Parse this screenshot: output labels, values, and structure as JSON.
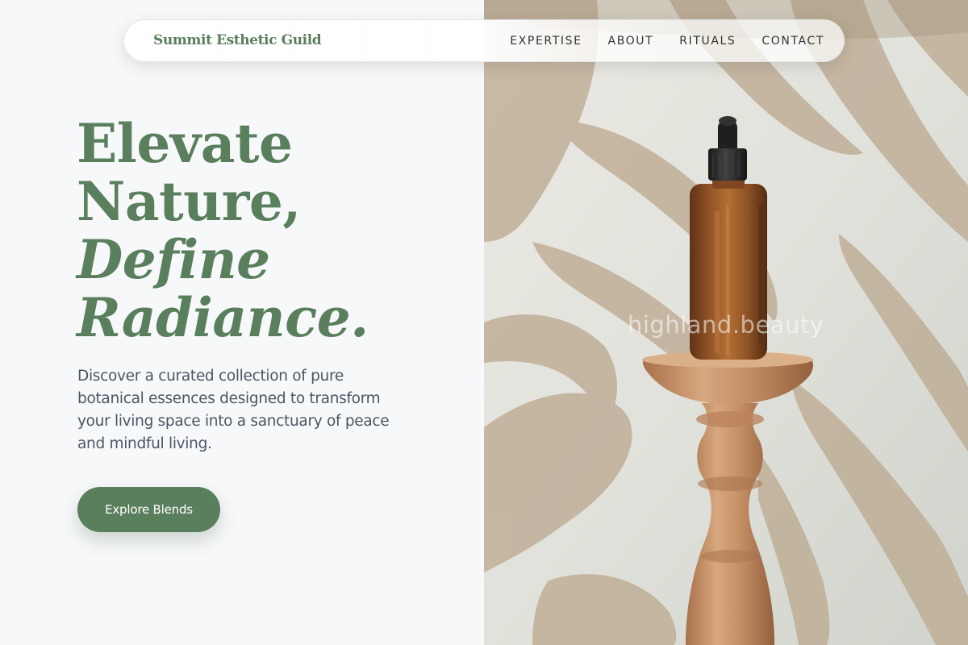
{
  "brand": {
    "name": "Summit Esthetic Guild"
  },
  "nav": {
    "links": [
      "EXPERTISE",
      "ABOUT",
      "RITUALS",
      "CONTACT"
    ]
  },
  "hero": {
    "headline_line1": "Elevate",
    "headline_line2": "Nature,",
    "headline_line3": "Define",
    "headline_line4": "Radiance.",
    "description": "Discover a curated collection of pure botanical essences designed to transform your living space into a sanctuary of peace and mindful living.",
    "cta_label": "Explore Blends"
  },
  "image": {
    "watermark": "highland.beauty",
    "subject": "amber dropper bottle on wooden pedestal with palm leaf shadows"
  },
  "colors": {
    "brand_green": "#5a7f5d",
    "text_gray": "#4a5663",
    "page_bg": "#f7f8fa",
    "bottle_amber": "#8a4a1c",
    "wood": "#c8956a"
  }
}
